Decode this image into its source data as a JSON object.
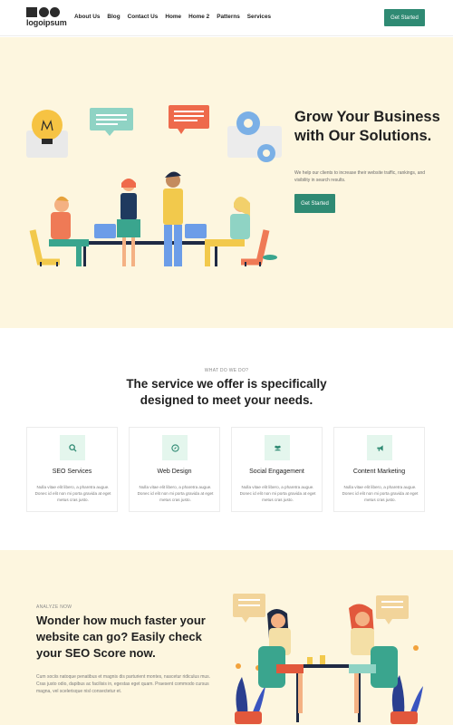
{
  "header": {
    "logo_text": "logoipsum",
    "nav": [
      "About Us",
      "Blog",
      "Contact Us",
      "Home",
      "Home 2",
      "Patterns",
      "Services"
    ],
    "cta": "Get Started"
  },
  "hero": {
    "title": "Grow Your Business with Our Solutions.",
    "description": "We help our clients to increase their website traffic, rankings, and visibility in search results.",
    "cta": "Get Started"
  },
  "services": {
    "eyebrow": "WHAT DO WE DO?",
    "title": "The service we offer is specifically designed to meet your needs.",
    "cards": [
      {
        "icon": "search-icon",
        "title": "SEO Services",
        "text": "Nulla vitae elit libero, a pharetra augue. Donec id elit non mi porta gravida at eget metus cras justo."
      },
      {
        "icon": "compass-icon",
        "title": "Web Design",
        "text": "Nulla vitae elit libero, a pharetra augue. Donec id elit non mi porta gravida at eget metus cras justo."
      },
      {
        "icon": "users-icon",
        "title": "Social Engagement",
        "text": "Nulla vitae elit libero, a pharetra augue. Donec id elit non mi porta gravida at eget metus cras justo."
      },
      {
        "icon": "megaphone-icon",
        "title": "Content Marketing",
        "text": "Nulla vitae elit libero, a pharetra augue. Donec id elit non mi porta gravida at eget metus cras justo."
      }
    ]
  },
  "analyze": {
    "eyebrow": "ANALYZE NOW",
    "title": "Wonder how much faster your website can go? Easily check your SEO Score now.",
    "text": "Cum sociis natoque penatibus et magnis dis parturient montes, nascetur ridiculus mus. Cras justo odio, dapibus ac facilisis in, egestas eget quam. Praesent commodo cursus magna, vel scelerisque nisl consectetur et."
  },
  "colors": {
    "accent": "#2f8a73",
    "hero_bg": "#fdf6df",
    "icon_bg": "#e4f6ed"
  }
}
